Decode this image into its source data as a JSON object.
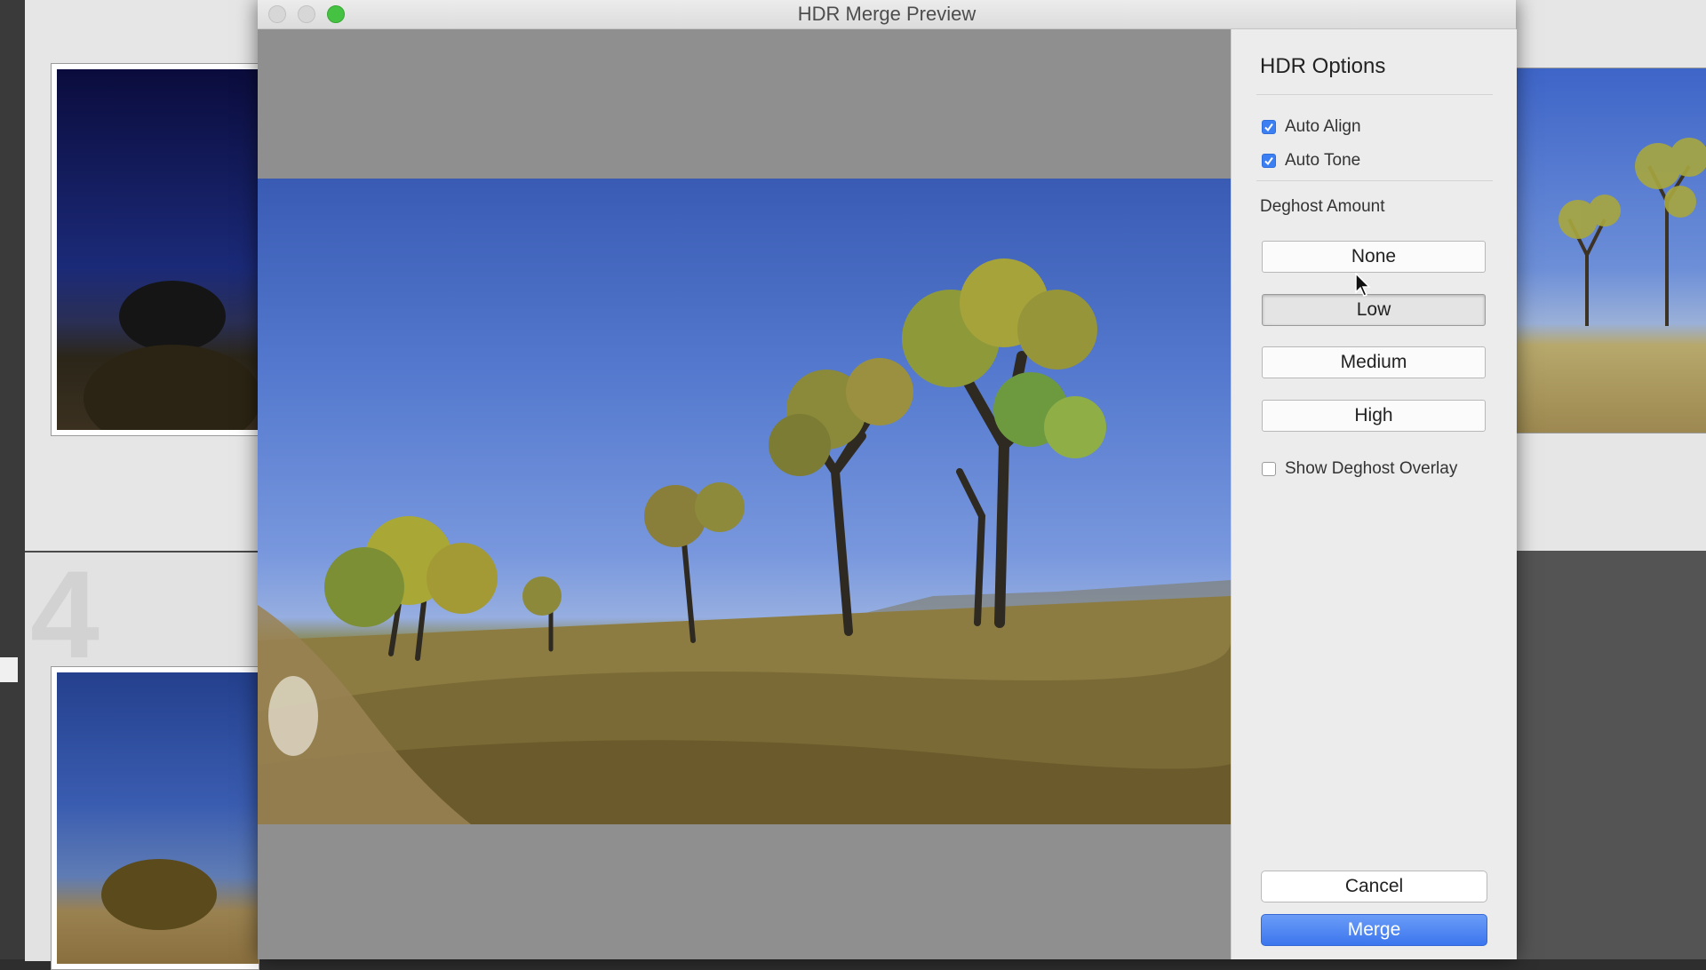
{
  "window": {
    "title": "HDR Merge Preview"
  },
  "background_grid": {
    "cell_numbers": [
      "4"
    ]
  },
  "options": {
    "title": "HDR Options",
    "auto_align": {
      "label": "Auto Align",
      "checked": true
    },
    "auto_tone": {
      "label": "Auto Tone",
      "checked": true
    },
    "deghost_label": "Deghost Amount",
    "deghost_options": [
      {
        "label": "None",
        "selected": false
      },
      {
        "label": "Low",
        "selected": true
      },
      {
        "label": "Medium",
        "selected": false
      },
      {
        "label": "High",
        "selected": false
      }
    ],
    "show_overlay": {
      "label": "Show Deghost Overlay",
      "checked": false
    }
  },
  "actions": {
    "cancel_label": "Cancel",
    "merge_label": "Merge"
  },
  "colors": {
    "accent": "#3b7ff3",
    "zoom_button": "#46c243"
  }
}
